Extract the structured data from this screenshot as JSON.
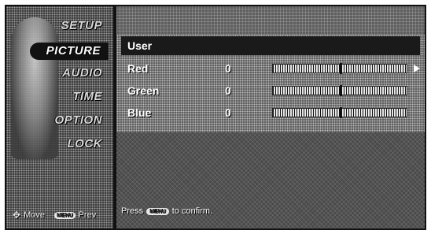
{
  "sidebar": {
    "items": [
      {
        "label": "SETUP"
      },
      {
        "label": "PICTURE"
      },
      {
        "label": "AUDIO"
      },
      {
        "label": "TIME"
      },
      {
        "label": "OPTION"
      },
      {
        "label": "LOCK"
      }
    ],
    "active_index": 1,
    "footer": {
      "move_label": "Move",
      "prev_key": "MENU",
      "prev_label": "Prev"
    }
  },
  "panel": {
    "title": "User",
    "rows": [
      {
        "label": "Red",
        "value": "0",
        "level_fraction": 0.5
      },
      {
        "label": "Green",
        "value": "0",
        "level_fraction": 0.5
      },
      {
        "label": "Blue",
        "value": "0",
        "level_fraction": 0.5
      }
    ],
    "hint": {
      "prefix": "Press",
      "key": "MENU",
      "suffix": "to confirm."
    }
  },
  "icons": {
    "move": "four-way-arrow-icon",
    "next": "right-arrow-icon"
  },
  "colors": {
    "highlight": "#1a1a1a",
    "text": "#ffffff"
  }
}
